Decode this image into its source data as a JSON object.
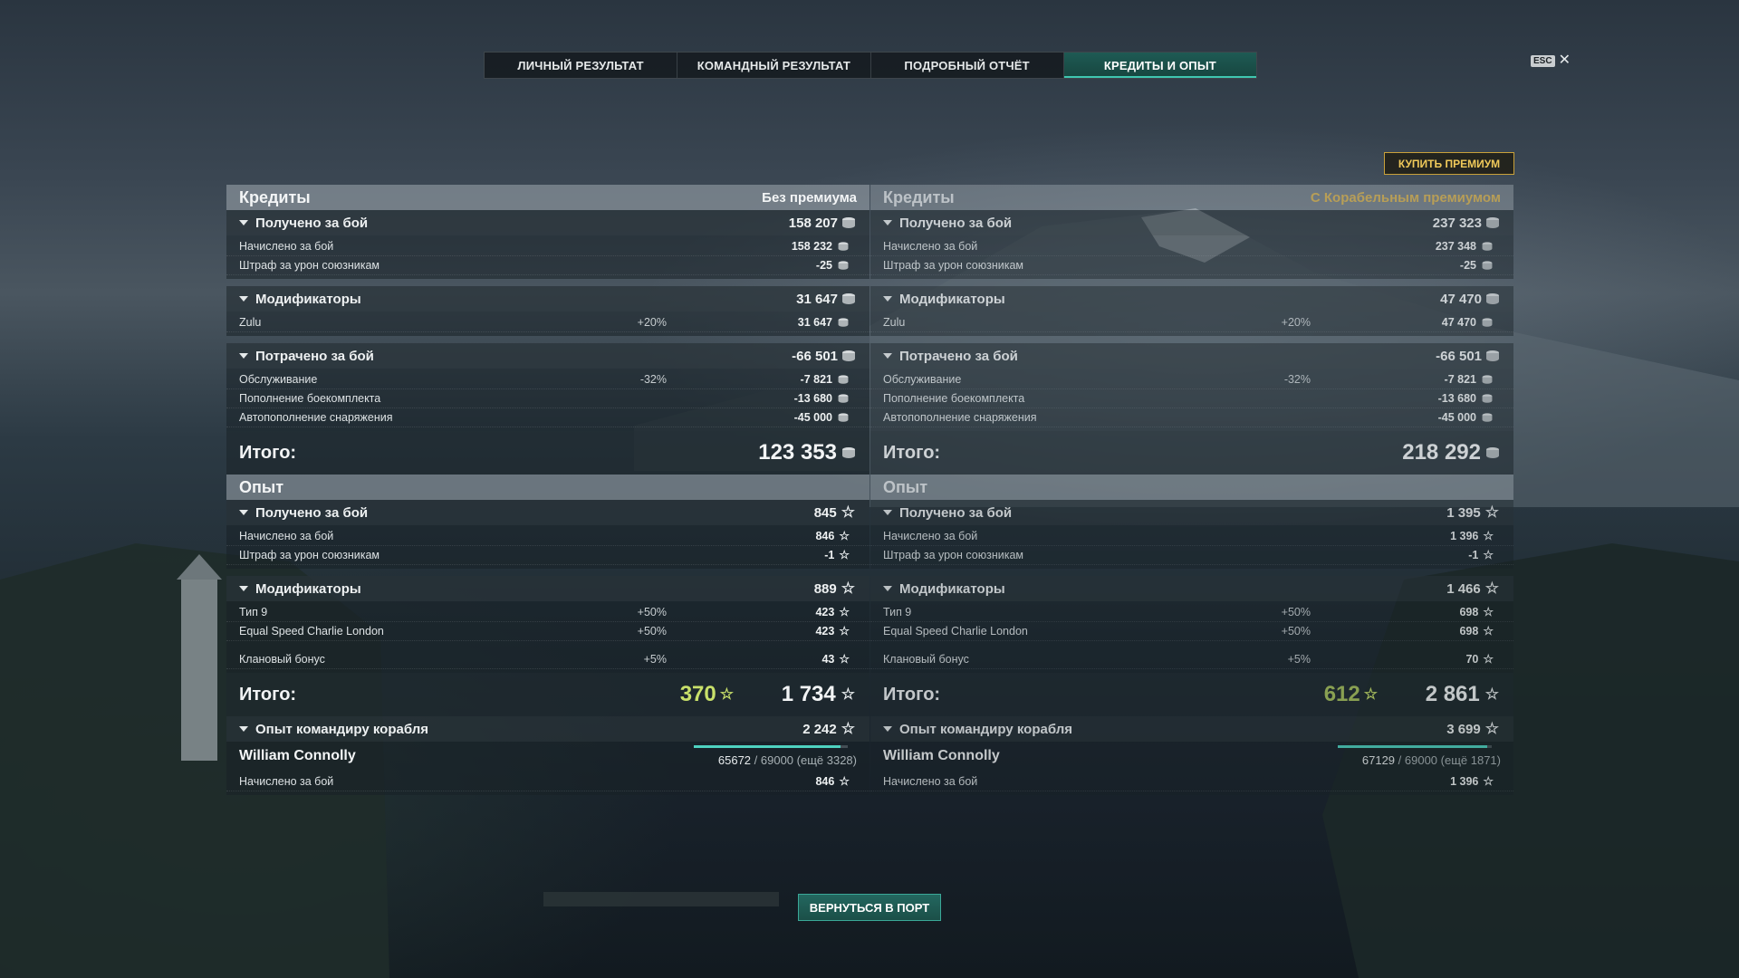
{
  "tabs": [
    {
      "label": "ЛИЧНЫЙ РЕЗУЛЬТАТ",
      "active": false
    },
    {
      "label": "КОМАНДНЫЙ РЕЗУЛЬТАТ",
      "active": false
    },
    {
      "label": "ПОДРОБНЫЙ ОТЧЁТ",
      "active": false
    },
    {
      "label": "КРЕДИТЫ И ОПЫТ",
      "active": true
    }
  ],
  "esc_label": "ESC",
  "buy_premium": "КУПИТЬ ПРЕМИУМ",
  "back_to_port": "ВЕРНУТЬСЯ В ПОРТ",
  "icons": {
    "credit": "credit-coin-icon",
    "xp": "xp-star-icon",
    "collapse": "triangle-down-icon",
    "close": "close-icon"
  },
  "colors": {
    "accent": "#3fc7b0",
    "premium_gold": "#d8b456",
    "bonus_green": "#c8e06a"
  },
  "left": {
    "credits_title": "Кредиты",
    "credits_subtitle": "Без премиума",
    "earned": {
      "label": "Получено за бой",
      "value": "158 207"
    },
    "earned_rows": [
      {
        "label": "Начислено за бой",
        "value": "158 232"
      },
      {
        "label": "Штраф за урон союзникам",
        "value": "-25"
      }
    ],
    "mods": {
      "label": "Модификаторы",
      "value": "31 647"
    },
    "mods_rows": [
      {
        "label": "Zulu",
        "pct": "+20%",
        "value": "31 647"
      }
    ],
    "spent": {
      "label": "Потрачено за бой",
      "value": "-66 501"
    },
    "spent_rows": [
      {
        "label": "Обслуживание",
        "pct": "-32%",
        "value": "-7 821"
      },
      {
        "label": "Пополнение боекомплекта",
        "value": "-13 680"
      },
      {
        "label": "Автопополнение снаряжения",
        "value": "-45 000"
      }
    ],
    "credits_total": {
      "label": "Итого:",
      "value": "123 353"
    },
    "xp_title": "Опыт",
    "xp_earned": {
      "label": "Получено за бой",
      "value": "845"
    },
    "xp_earned_rows": [
      {
        "label": "Начислено за бой",
        "value": "846"
      },
      {
        "label": "Штраф за урон союзникам",
        "value": "-1"
      }
    ],
    "xp_mods": {
      "label": "Модификаторы",
      "value": "889"
    },
    "xp_mods_rows": [
      {
        "label": "Тип 9",
        "pct": "+50%",
        "value": "423"
      },
      {
        "label": "Equal Speed Charlie London",
        "pct": "+50%",
        "value": "423"
      },
      {
        "label": "Клановый бонус",
        "pct": "+5%",
        "value": "43"
      }
    ],
    "xp_total": {
      "label": "Итого:",
      "bonus": "370",
      "value": "1 734"
    },
    "cmd": {
      "label": "Опыт командиру корабля",
      "value": "2 242"
    },
    "commander": {
      "name": "William Connolly",
      "current": "65672",
      "rest": " / 69000 (ещё 3328)",
      "progress": 0.952
    },
    "cmd_rows": [
      {
        "label": "Начислено за бой",
        "value": "846"
      }
    ]
  },
  "right": {
    "credits_title": "Кредиты",
    "credits_subtitle": "С Корабельным премиумом",
    "earned": {
      "label": "Получено за бой",
      "value": "237 323"
    },
    "earned_rows": [
      {
        "label": "Начислено за бой",
        "value": "237 348"
      },
      {
        "label": "Штраф за урон союзникам",
        "value": "-25"
      }
    ],
    "mods": {
      "label": "Модификаторы",
      "value": "47 470"
    },
    "mods_rows": [
      {
        "label": "Zulu",
        "pct": "+20%",
        "value": "47 470"
      }
    ],
    "spent": {
      "label": "Потрачено за бой",
      "value": "-66 501"
    },
    "spent_rows": [
      {
        "label": "Обслуживание",
        "pct": "-32%",
        "value": "-7 821"
      },
      {
        "label": "Пополнение боекомплекта",
        "value": "-13 680"
      },
      {
        "label": "Автопополнение снаряжения",
        "value": "-45 000"
      }
    ],
    "credits_total": {
      "label": "Итого:",
      "value": "218 292"
    },
    "xp_title": "Опыт",
    "xp_earned": {
      "label": "Получено за бой",
      "value": "1 395"
    },
    "xp_earned_rows": [
      {
        "label": "Начислено за бой",
        "value": "1 396"
      },
      {
        "label": "Штраф за урон союзникам",
        "value": "-1"
      }
    ],
    "xp_mods": {
      "label": "Модификаторы",
      "value": "1 466"
    },
    "xp_mods_rows": [
      {
        "label": "Тип 9",
        "pct": "+50%",
        "value": "698"
      },
      {
        "label": "Equal Speed Charlie London",
        "pct": "+50%",
        "value": "698"
      },
      {
        "label": "Клановый бонус",
        "pct": "+5%",
        "value": "70"
      }
    ],
    "xp_total": {
      "label": "Итого:",
      "bonus": "612",
      "value": "2 861"
    },
    "cmd": {
      "label": "Опыт командиру корабля",
      "value": "3 699"
    },
    "commander": {
      "name": "William Connolly",
      "current": "67129",
      "rest": " / 69000 (ещё 1871)",
      "progress": 0.973
    },
    "cmd_rows": [
      {
        "label": "Начислено за бой",
        "value": "1 396"
      }
    ]
  }
}
